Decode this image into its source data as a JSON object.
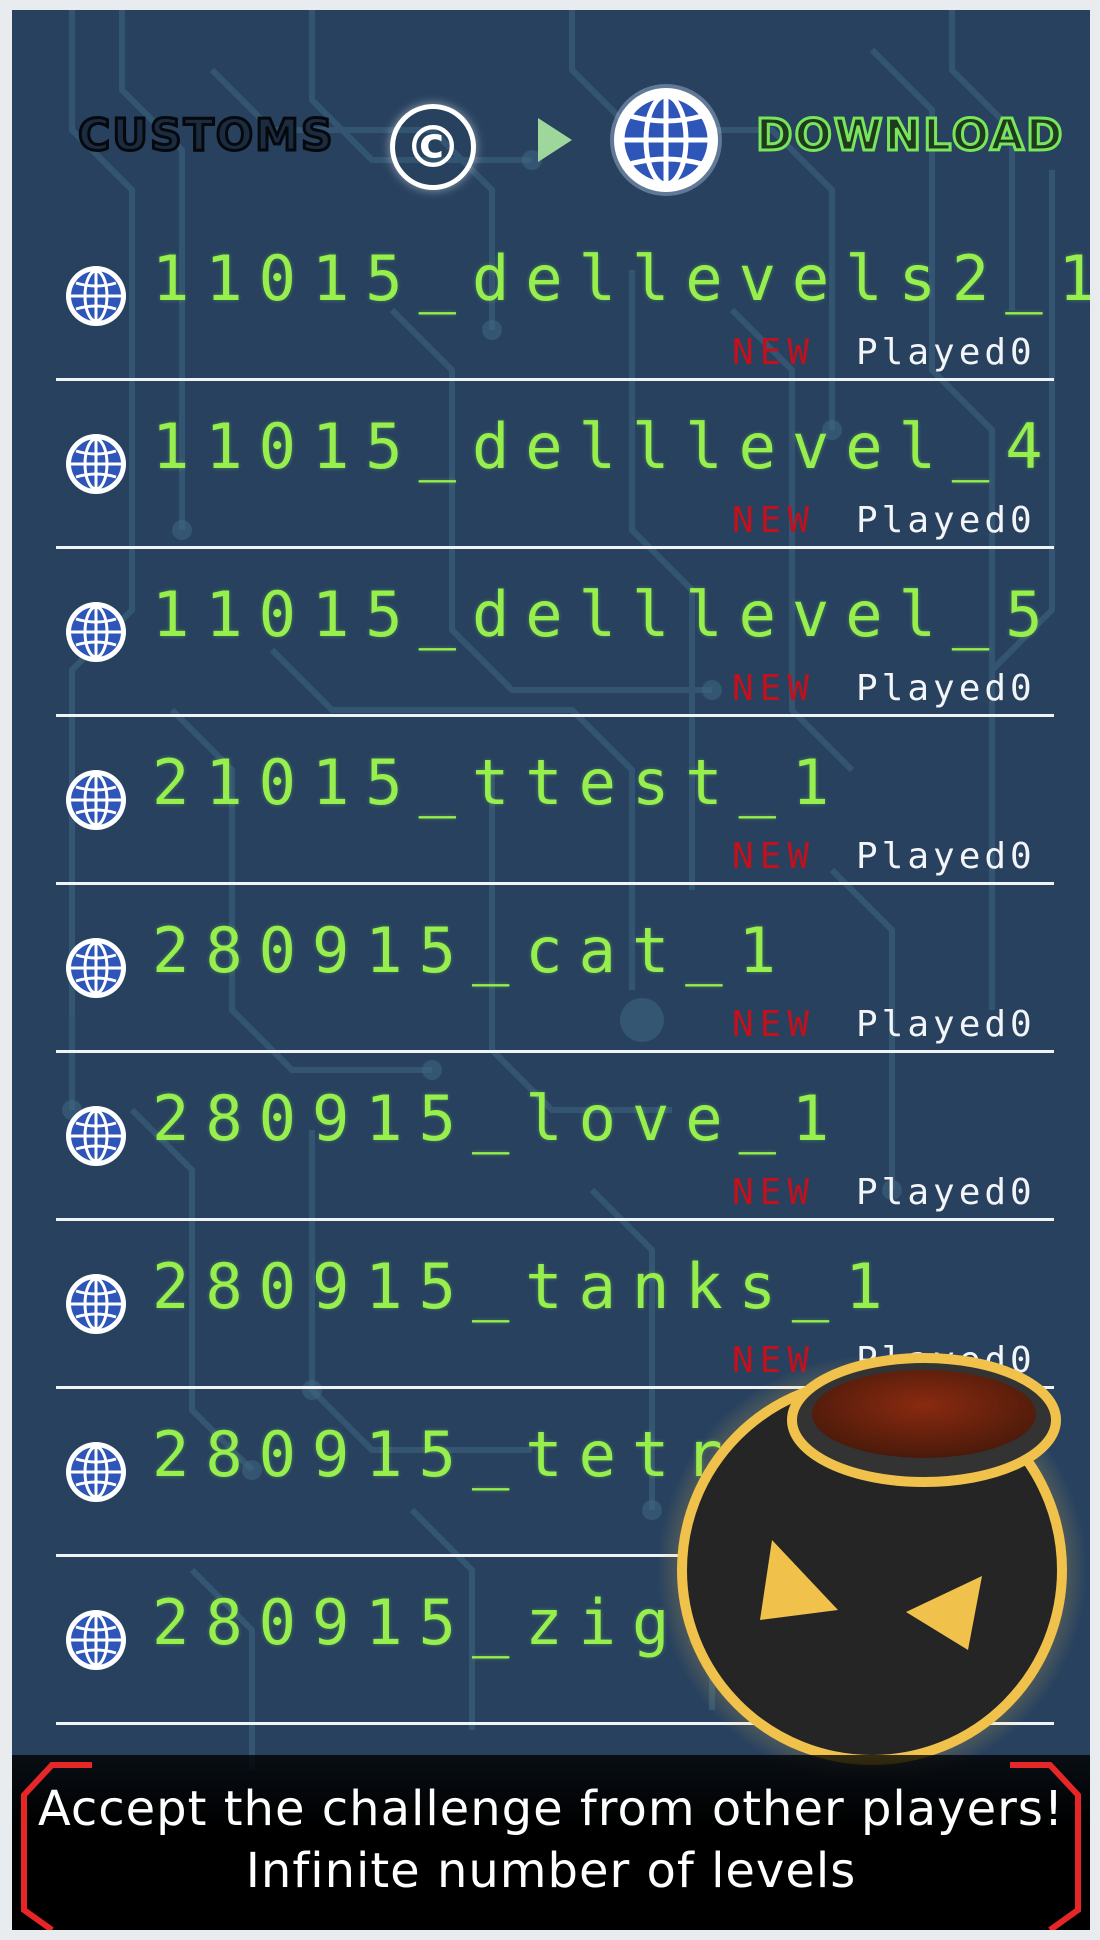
{
  "header": {
    "customs_label": "CUSTOMS",
    "copyright_symbol": "©",
    "download_label": "DOWNLOAD"
  },
  "levels": [
    {
      "name": "11015_dellevels2_1",
      "badge": "NEW",
      "played": "Played0"
    },
    {
      "name": "11015_delllevel_4",
      "badge": "NEW",
      "played": "Played0"
    },
    {
      "name": "11015_delllevel_5",
      "badge": "NEW",
      "played": "Played0"
    },
    {
      "name": "21015_ttest_1",
      "badge": "NEW",
      "played": "Played0"
    },
    {
      "name": "280915_cat_1",
      "badge": "NEW",
      "played": "Played0"
    },
    {
      "name": "280915_love_1",
      "badge": "NEW",
      "played": "Played0"
    },
    {
      "name": "280915_tanks_1",
      "badge": "NEW",
      "played": "Played0"
    },
    {
      "name": "280915_tetr",
      "badge": "",
      "played": ""
    },
    {
      "name": "280915_zigz",
      "badge": "",
      "played": ""
    }
  ],
  "banner": {
    "line1": "Accept the challenge from other players!",
    "line2": "Infinite number of levels"
  },
  "colors": {
    "background": "#27415f",
    "level_name": "#96ef4d",
    "new_badge": "#c0111c",
    "accent_yellow": "#f0c14b"
  },
  "icons": [
    "copyright-icon",
    "play-arrow-icon",
    "globe-icon",
    "mascot-icon"
  ]
}
